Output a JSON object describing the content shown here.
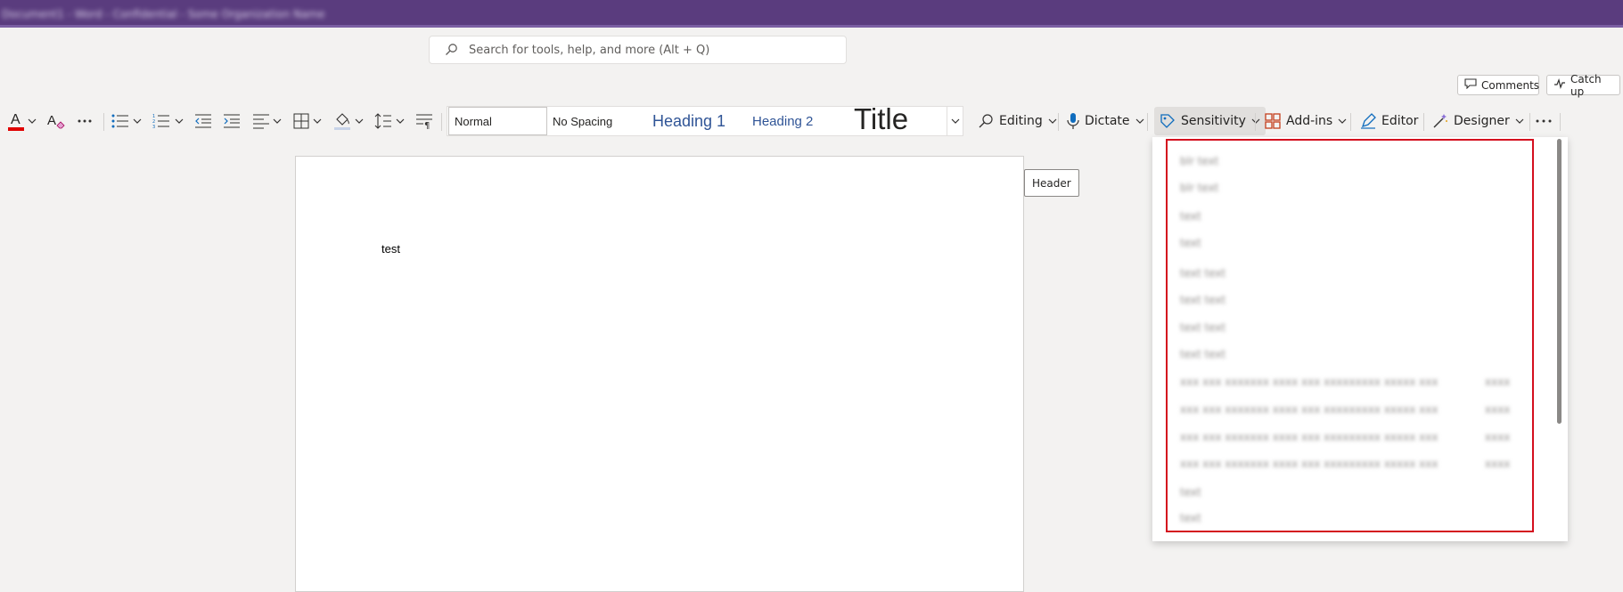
{
  "titlebar": {
    "blurred_text": "Document1 - Word - Confidential - Some Organization Name"
  },
  "search": {
    "placeholder": "Search for tools, help, and more (Alt + Q)"
  },
  "top_actions": {
    "comments": "Comments",
    "catch_up": "Catch up"
  },
  "colors": {
    "titlebar": "#5a3c7e",
    "accent_red": "#d40f1e",
    "heading_blue": "#2f5496",
    "font_color_bar": "#e00000"
  },
  "styles_gallery": {
    "items": [
      "Normal",
      "No Spacing",
      "Heading 1",
      "Heading 2",
      "Title"
    ]
  },
  "ribbon": {
    "editing": "Editing",
    "dictate": "Dictate",
    "sensitivity": "Sensitivity",
    "addins": "Add-ins",
    "editor": "Editor",
    "designer": "Designer"
  },
  "document": {
    "body_text": "test",
    "header_tag": "Header"
  },
  "sensitivity_menu": {
    "items": [
      {
        "label": "blr text",
        "tail": ""
      },
      {
        "label": "blr text",
        "tail": ""
      },
      {
        "label": "text",
        "tail": ""
      },
      {
        "label": "text",
        "tail": ""
      },
      {
        "label": "text text",
        "tail": ""
      },
      {
        "label": "text text",
        "tail": ""
      },
      {
        "label": "text text",
        "tail": ""
      },
      {
        "label": "text text",
        "tail": ""
      },
      {
        "label": "xxx xxx xxxxxxx xxxx xxx xxxxxxxxx xxxxx xxx",
        "tail": "xxxx"
      },
      {
        "label": "xxx xxx xxxxxxx xxxx xxx xxxxxxxxx xxxxx xxx",
        "tail": "xxxx"
      },
      {
        "label": "xxx xxx xxxxxxx xxxx xxx xxxxxxxxx xxxxx xxx",
        "tail": "xxxx"
      },
      {
        "label": "xxx xxx xxxxxxx xxxx xxx xxxxxxxxx xxxxx xxx",
        "tail": "xxxx"
      },
      {
        "label": "text",
        "tail": ""
      },
      {
        "label": "text",
        "tail": ""
      }
    ]
  }
}
